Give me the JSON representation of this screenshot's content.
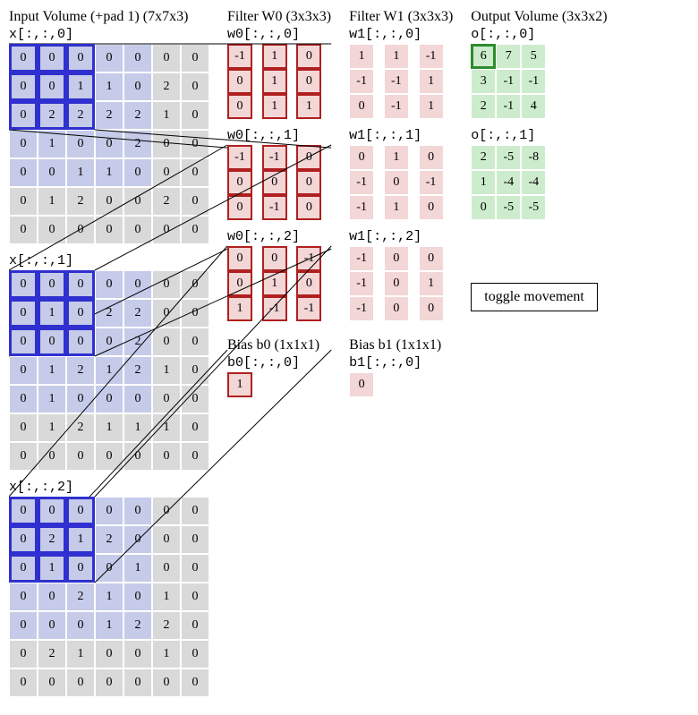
{
  "titles": {
    "input": "Input Volume (+pad 1) (7x7x3)",
    "w0": "Filter W0 (3x3x3)",
    "w1": "Filter W1 (3x3x3)",
    "out": "Output Volume (3x3x2)",
    "b0": "Bias b0 (1x1x1)",
    "b1": "Bias b1 (1x1x1)"
  },
  "labels": {
    "x0": "x[:,:,0]",
    "x1": "x[:,:,1]",
    "x2": "x[:,:,2]",
    "w00": "w0[:,:,0]",
    "w01": "w0[:,:,1]",
    "w02": "w0[:,:,2]",
    "w10": "w1[:,:,0]",
    "w11": "w1[:,:,1]",
    "w12": "w1[:,:,2]",
    "b0": "b0[:,:,0]",
    "b1": "b1[:,:,0]",
    "o0": "o[:,:,0]",
    "o1": "o[:,:,1]"
  },
  "input": {
    "x0": [
      [
        0,
        0,
        0,
        0,
        0,
        0,
        0
      ],
      [
        0,
        0,
        1,
        1,
        0,
        2,
        0
      ],
      [
        0,
        2,
        2,
        2,
        2,
        1,
        0
      ],
      [
        0,
        1,
        0,
        0,
        2,
        0,
        0
      ],
      [
        0,
        0,
        1,
        1,
        0,
        0,
        0
      ],
      [
        0,
        1,
        2,
        0,
        0,
        2,
        0
      ],
      [
        0,
        0,
        0,
        0,
        0,
        0,
        0
      ]
    ],
    "x1": [
      [
        0,
        0,
        0,
        0,
        0,
        0,
        0
      ],
      [
        0,
        1,
        0,
        2,
        2,
        0,
        0
      ],
      [
        0,
        0,
        0,
        0,
        2,
        0,
        0
      ],
      [
        0,
        1,
        2,
        1,
        2,
        1,
        0
      ],
      [
        0,
        1,
        0,
        0,
        0,
        0,
        0
      ],
      [
        0,
        1,
        2,
        1,
        1,
        1,
        0
      ],
      [
        0,
        0,
        0,
        0,
        0,
        0,
        0
      ]
    ],
    "x2": [
      [
        0,
        0,
        0,
        0,
        0,
        0,
        0
      ],
      [
        0,
        2,
        1,
        2,
        0,
        0,
        0
      ],
      [
        0,
        1,
        0,
        0,
        1,
        0,
        0
      ],
      [
        0,
        0,
        2,
        1,
        0,
        1,
        0
      ],
      [
        0,
        0,
        0,
        1,
        2,
        2,
        0
      ],
      [
        0,
        2,
        1,
        0,
        0,
        1,
        0
      ],
      [
        0,
        0,
        0,
        0,
        0,
        0,
        0
      ]
    ]
  },
  "w0": {
    "d0": [
      [
        -1,
        1,
        0
      ],
      [
        0,
        1,
        0
      ],
      [
        0,
        1,
        1
      ]
    ],
    "d1": [
      [
        -1,
        -1,
        0
      ],
      [
        0,
        0,
        0
      ],
      [
        0,
        -1,
        0
      ]
    ],
    "d2": [
      [
        0,
        0,
        -1
      ],
      [
        0,
        1,
        0
      ],
      [
        1,
        -1,
        -1
      ]
    ]
  },
  "w1": {
    "d0": [
      [
        1,
        1,
        -1
      ],
      [
        -1,
        -1,
        1
      ],
      [
        0,
        -1,
        1
      ]
    ],
    "d1": [
      [
        0,
        1,
        0
      ],
      [
        -1,
        0,
        -1
      ],
      [
        -1,
        1,
        0
      ]
    ],
    "d2": [
      [
        -1,
        0,
        0
      ],
      [
        -1,
        0,
        1
      ],
      [
        -1,
        0,
        0
      ]
    ]
  },
  "b0": 1,
  "b1": 0,
  "out": {
    "o0": [
      [
        6,
        7,
        5
      ],
      [
        3,
        -1,
        -1
      ],
      [
        2,
        -1,
        4
      ]
    ],
    "o1": [
      [
        2,
        -5,
        -8
      ],
      [
        1,
        -4,
        -4
      ],
      [
        0,
        -5,
        -5
      ]
    ]
  },
  "toggle": "toggle movement",
  "chart_data": {
    "type": "table",
    "description": "Convolution demo: 7x7x3 padded input, two 3x3x3 filters with biases, producing 3x3x2 output. Current receptive-field window is top-left 3x3 (rows 0-2, cols 0-2) of each input depth slice; current output position is o[:,:,0][0,0] = 6.",
    "input_shape": [
      7,
      7,
      3
    ],
    "filter_shape": [
      3,
      3,
      3
    ],
    "num_filters": 2,
    "output_shape": [
      3,
      3,
      2
    ],
    "pad": 1,
    "stride": 2,
    "window_origin": [
      0,
      0
    ],
    "current_output_index": [
      0,
      0,
      0
    ]
  }
}
